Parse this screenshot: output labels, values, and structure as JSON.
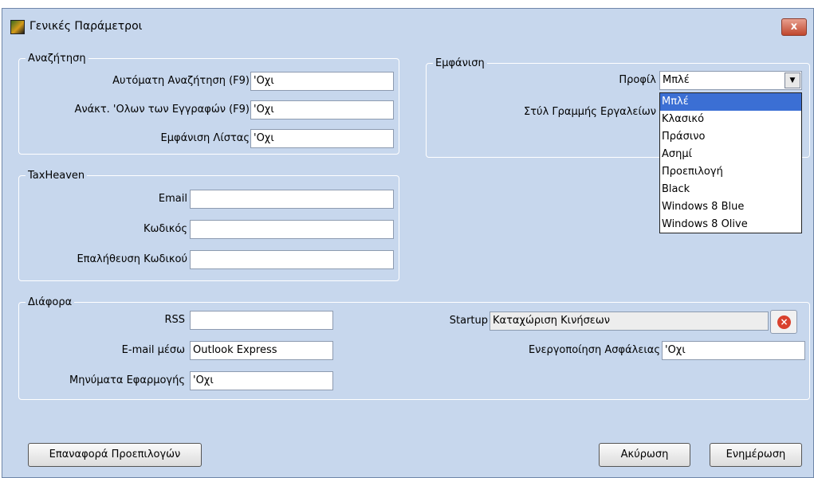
{
  "window": {
    "title": "Γενικές Παράμετροι",
    "close_glyph": "x"
  },
  "search": {
    "legend": "Αναζήτηση",
    "auto_search_label": "Αυτόματη Αναζήτηση (F9)",
    "auto_search_value": "'Οχι",
    "fetch_all_label": "Ανάκτ. 'Ολων των Εγγραφών (F9)",
    "fetch_all_value": "'Οχι",
    "show_list_label": "Εμφάνιση Λίστας",
    "show_list_value": "'Οχι"
  },
  "appearance": {
    "legend": "Εμφάνιση",
    "profile_label": "Προφίλ",
    "profile_value": "Μπλέ",
    "toolbar_style_label": "Στύλ Γραμμής Εργαλείων",
    "options": [
      "Μπλέ",
      "Κλασικό",
      "Πράσινο",
      "Ασημί",
      "Προεπιλογή",
      "Black",
      "Windows 8 Blue",
      "Windows 8 Olive"
    ]
  },
  "taxheaven": {
    "legend": "TaxHeaven",
    "email_label": "Email",
    "email_value": "",
    "password_label": "Κωδικός",
    "password_value": "",
    "confirm_label": "Επαλήθευση Κωδικού",
    "confirm_value": ""
  },
  "misc": {
    "legend": "Διάφορα",
    "rss_label": "RSS",
    "rss_value": "",
    "email_via_label": "E-mail μέσω",
    "email_via_value": "Outlook Express",
    "messages_label": "Μηνύματα Εφαρμογής",
    "messages_value": "'Οχι",
    "startup_label": "Startup",
    "startup_value": "Καταχώριση Κινήσεων",
    "security_label": "Ενεργοποίηση Ασφάλειας",
    "security_value": "'Οχι"
  },
  "buttons": {
    "reset": "Επαναφορά Προεπιλογών",
    "cancel": "Ακύρωση",
    "update": "Ενημέρωση"
  },
  "colors": {
    "background": "#c7d7ed",
    "selection": "#3b6fd4",
    "close": "#c0472e"
  },
  "icons": [
    "app-icon",
    "close-icon",
    "chevron-down-icon",
    "clear-icon"
  ]
}
